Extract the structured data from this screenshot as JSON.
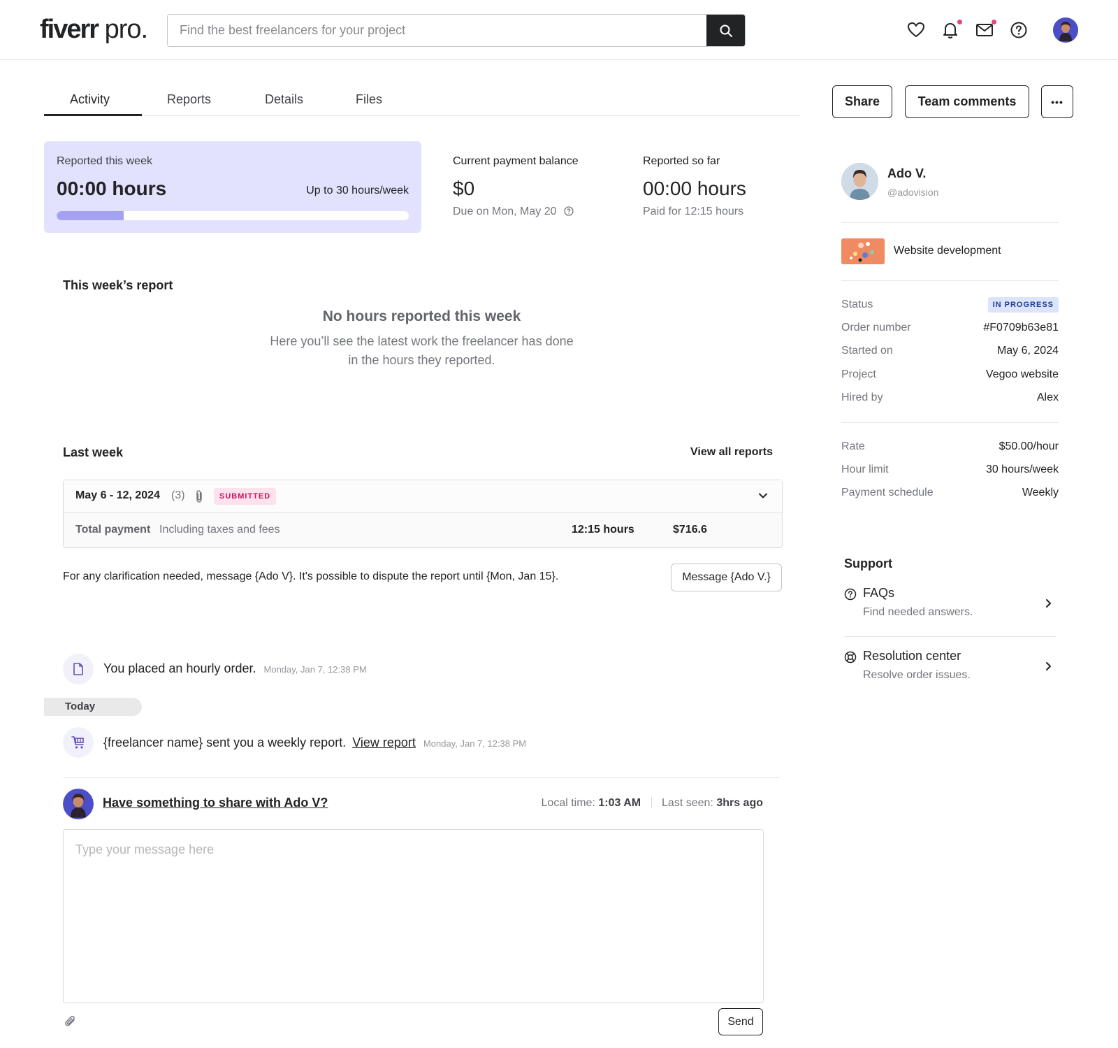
{
  "header": {
    "logo_main": "fiverr",
    "logo_pro": " pro.",
    "search_placeholder": "Find the best freelancers for your project"
  },
  "tabs": [
    {
      "label": "Activity",
      "active": true
    },
    {
      "label": "Reports"
    },
    {
      "label": "Details"
    },
    {
      "label": "Files"
    }
  ],
  "actions": {
    "share": "Share",
    "team_comments": "Team comments",
    "more": "•••"
  },
  "stats": {
    "week_label": "Reported this week",
    "week_value": "00:00 hours",
    "week_limit": "Up to 30 hours/week",
    "week_progress_percent": 19,
    "balance_label": "Current payment balance",
    "balance_value": "$0",
    "balance_due": "Due on Mon, May 20",
    "so_far_label": "Reported so far",
    "so_far_value": "00:00 hours",
    "so_far_paid": "Paid for 12:15 hours"
  },
  "this_week": {
    "title": "This week’s report",
    "empty_title": "No hours reported this week",
    "empty_line1": "Here you’ll see the latest work the freelancer has done",
    "empty_line2": "in the hours they reported."
  },
  "last_week": {
    "title": "Last week",
    "view_all": "View all reports",
    "range": "May 6 - 12, 2024",
    "count": "(3)",
    "status": "SUBMITTED",
    "total_label": "Total payment",
    "total_sub": "Including taxes and fees",
    "hours": "12:15 hours",
    "amount": "$716.6",
    "clarification": "For any clarification needed, message {Ado V}. It's possible to dispute the report until {Mon, Jan 15}.",
    "message_button": "Message {Ado V.}"
  },
  "activity": {
    "order_text": "You placed an hourly order.",
    "order_time": "Monday, Jan 7, 12:38 PM",
    "today": "Today",
    "report_text": "{freelancer name} sent you a weekly report.",
    "report_link": "View report",
    "report_time": "Monday, Jan 7, 12:38 PM"
  },
  "composer": {
    "prompt": "Have something to share with Ado V?",
    "local_time_label": "Local time:",
    "local_time_value": "1:03 AM",
    "last_seen_label": "Last seen:",
    "last_seen_value": "3hrs ago",
    "placeholder": "Type your message here",
    "send": "Send"
  },
  "sidebar": {
    "name": "Ado V.",
    "handle": "@adovision",
    "gig": "Website development",
    "details": [
      {
        "key": "Status",
        "value": "IN PROGRESS"
      },
      {
        "key": "Order number",
        "value": "#F0709b63e81"
      },
      {
        "key": "Started on",
        "value": "May 6, 2024"
      },
      {
        "key": "Project",
        "value": "Vegoo website"
      },
      {
        "key": "Hired by",
        "value": "Alex"
      }
    ],
    "terms": [
      {
        "key": "Rate",
        "value": "$50.00/hour"
      },
      {
        "key": "Hour limit",
        "value": "30 hours/week"
      },
      {
        "key": "Payment schedule",
        "value": "Weekly"
      }
    ],
    "support_title": "Support",
    "support": [
      {
        "title": "FAQs",
        "sub": "Find needed answers."
      },
      {
        "title": "Resolution center",
        "sub": "Resolve order issues."
      }
    ]
  },
  "colors": {
    "week_card_bg": "#e2e2fe",
    "progress_fill": "#a6a2f3",
    "notification_dot": "#e8437a",
    "submitted_badge_bg": "#fde2ee",
    "status_badge_bg": "#dbe4fb"
  }
}
